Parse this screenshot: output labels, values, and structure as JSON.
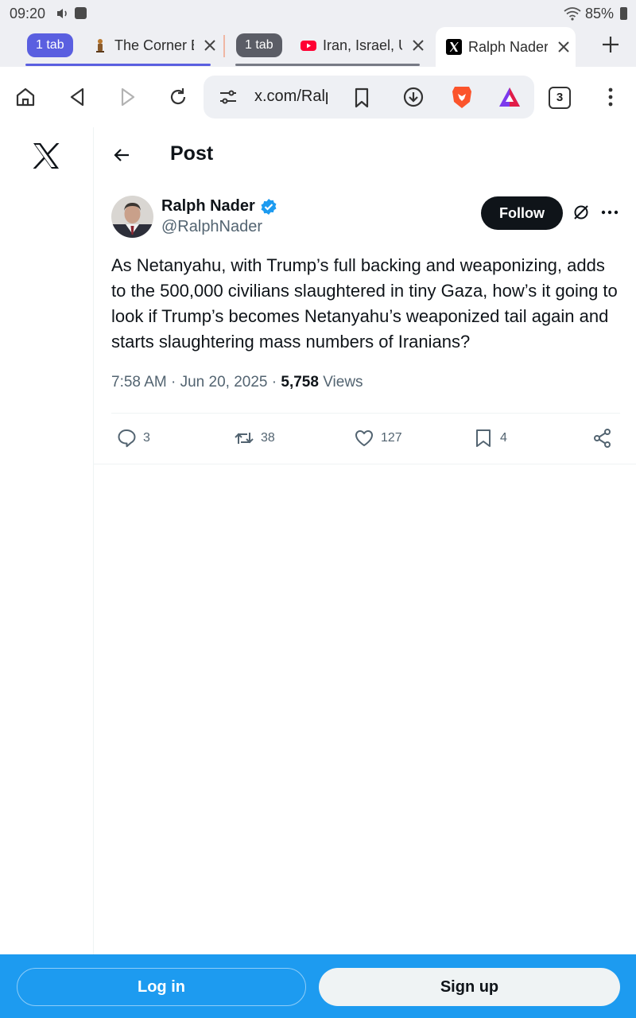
{
  "status_bar": {
    "time": "09:20",
    "battery": "85%"
  },
  "tabs": {
    "group1_count": "1 tab",
    "group1_tab_title": "The Corner E",
    "group2_count": "1 tab",
    "group2_tab_title": "Iran, Israel, U",
    "active_tab_title": "Ralph Nader"
  },
  "toolbar": {
    "url": "x.com/RalphNader",
    "tab_count": "3"
  },
  "page": {
    "title": "Post"
  },
  "tweet": {
    "author_name": "Ralph Nader",
    "author_handle": "@RalphNader",
    "follow_label": "Follow",
    "text": "As Netanyahu, with Trump’s full backing and weaponizing, adds to the 500,000 civilians slaughtered in tiny Gaza, how’s it going to look if Trump’s becomes Netanyahu’s weaponized tail again and starts slaughtering mass numbers of Iranians?",
    "time": "7:58 AM",
    "date": "Jun 20, 2025",
    "views_count": "5,758",
    "views_label": "Views",
    "replies": "3",
    "reposts": "38",
    "likes": "127",
    "bookmarks": "4"
  },
  "bottom_bar": {
    "login_label": "Log in",
    "signup_label": "Sign up"
  },
  "colors": {
    "accent_blue": "#1d9bf0",
    "tab_group_blue": "#5a5fe0",
    "text_primary": "#0f1419",
    "text_secondary": "#536471"
  }
}
